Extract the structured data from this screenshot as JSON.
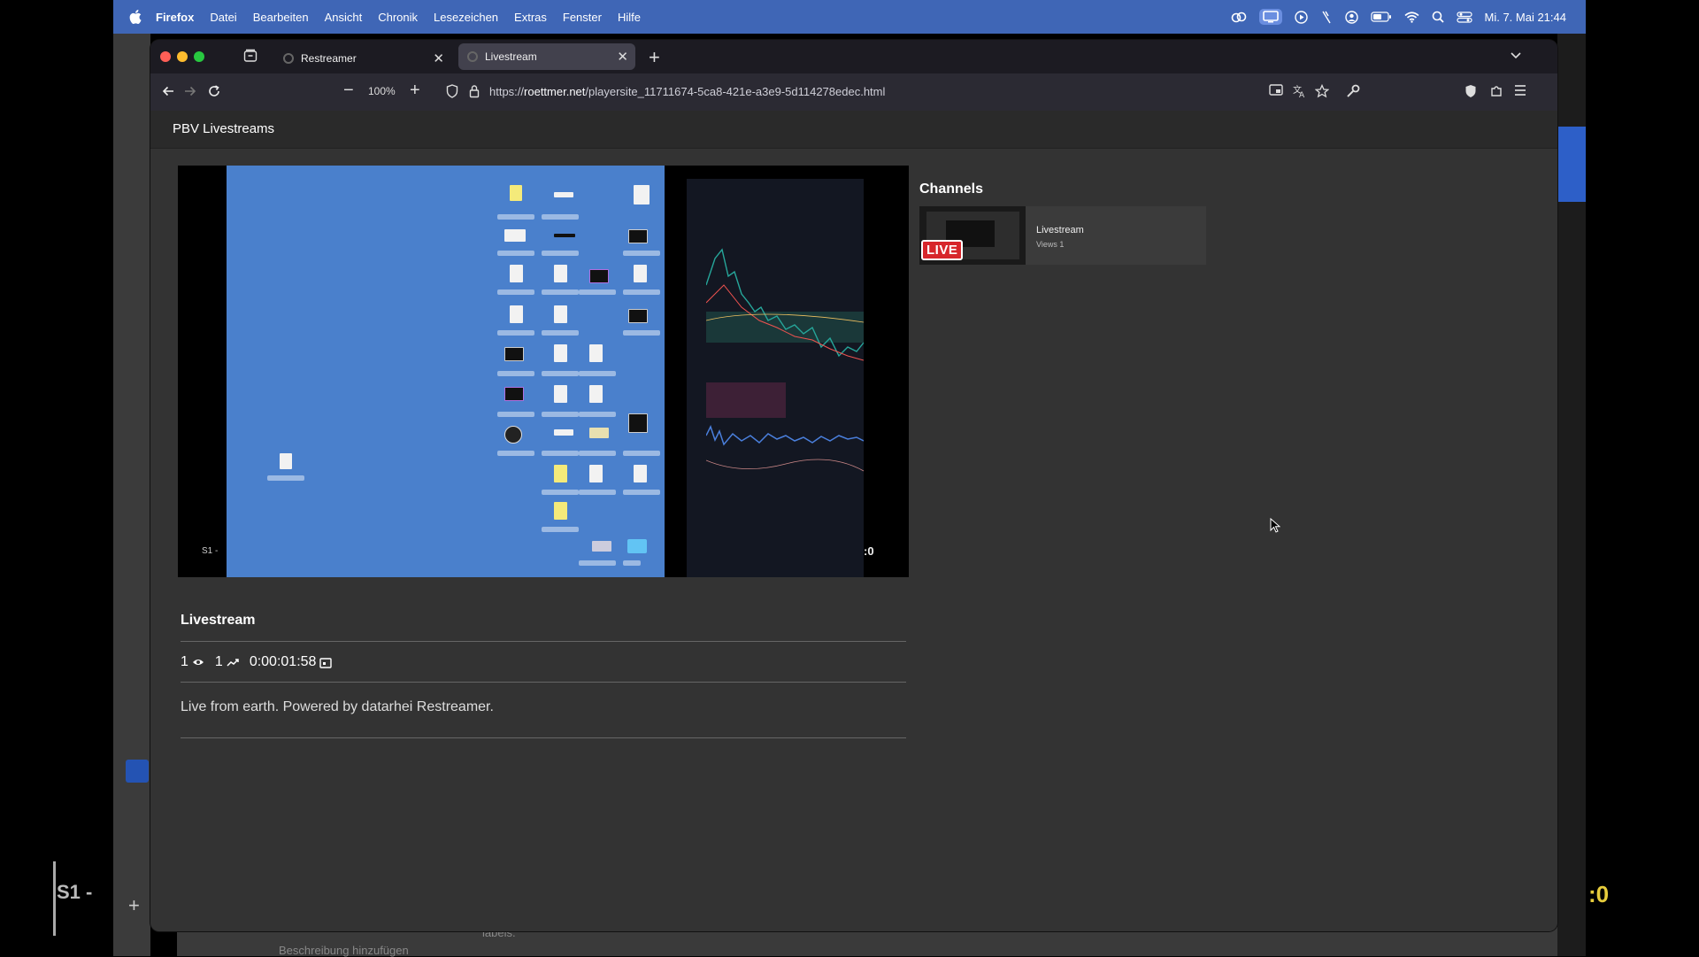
{
  "menubar": {
    "items": [
      "Firefox",
      "Datei",
      "Bearbeiten",
      "Ansicht",
      "Chronik",
      "Lesezeichen",
      "Extras",
      "Fenster",
      "Hilfe"
    ],
    "clock": "Mi. 7. Mai 21:44",
    "icons": [
      "apple-icon",
      "creative-cloud-icon",
      "screen-cast-icon",
      "play-icon",
      "bolt-icon",
      "user-icon",
      "battery-icon",
      "wifi-icon",
      "spotlight-icon",
      "control-center-icon"
    ]
  },
  "browser": {
    "tabs": [
      {
        "title": "Restreamer",
        "active": false
      },
      {
        "title": "Livestream",
        "active": true
      }
    ],
    "zoom": "100%",
    "url_prefix": "https://",
    "url_domain": "roettmer.net",
    "url_path": "/playersite_11711674-5ca8-421e-a3e9-5d114278edec.html"
  },
  "site": {
    "title": "PBV Livestreams",
    "channels_heading": "Channels",
    "channel": {
      "name": "Livestream",
      "views": "Views 1",
      "badge": "LIVE"
    },
    "stream": {
      "title": "Livestream",
      "viewers": "1",
      "trend": "1",
      "uptime": "0:00:01:58",
      "description": "Live from earth. Powered by datarhei Restreamer."
    },
    "player_overlay": {
      "left": "S1 -",
      "right": ":0"
    }
  },
  "background": {
    "left_label": "S1 -",
    "right_label": ":0",
    "bottom_text_1": "labels.",
    "bottom_text_2": "Beschreibung hinzufügen"
  },
  "colors": {
    "menubar": "#3f66b6",
    "live": "#d7262b",
    "desk": "#4a80cc"
  }
}
